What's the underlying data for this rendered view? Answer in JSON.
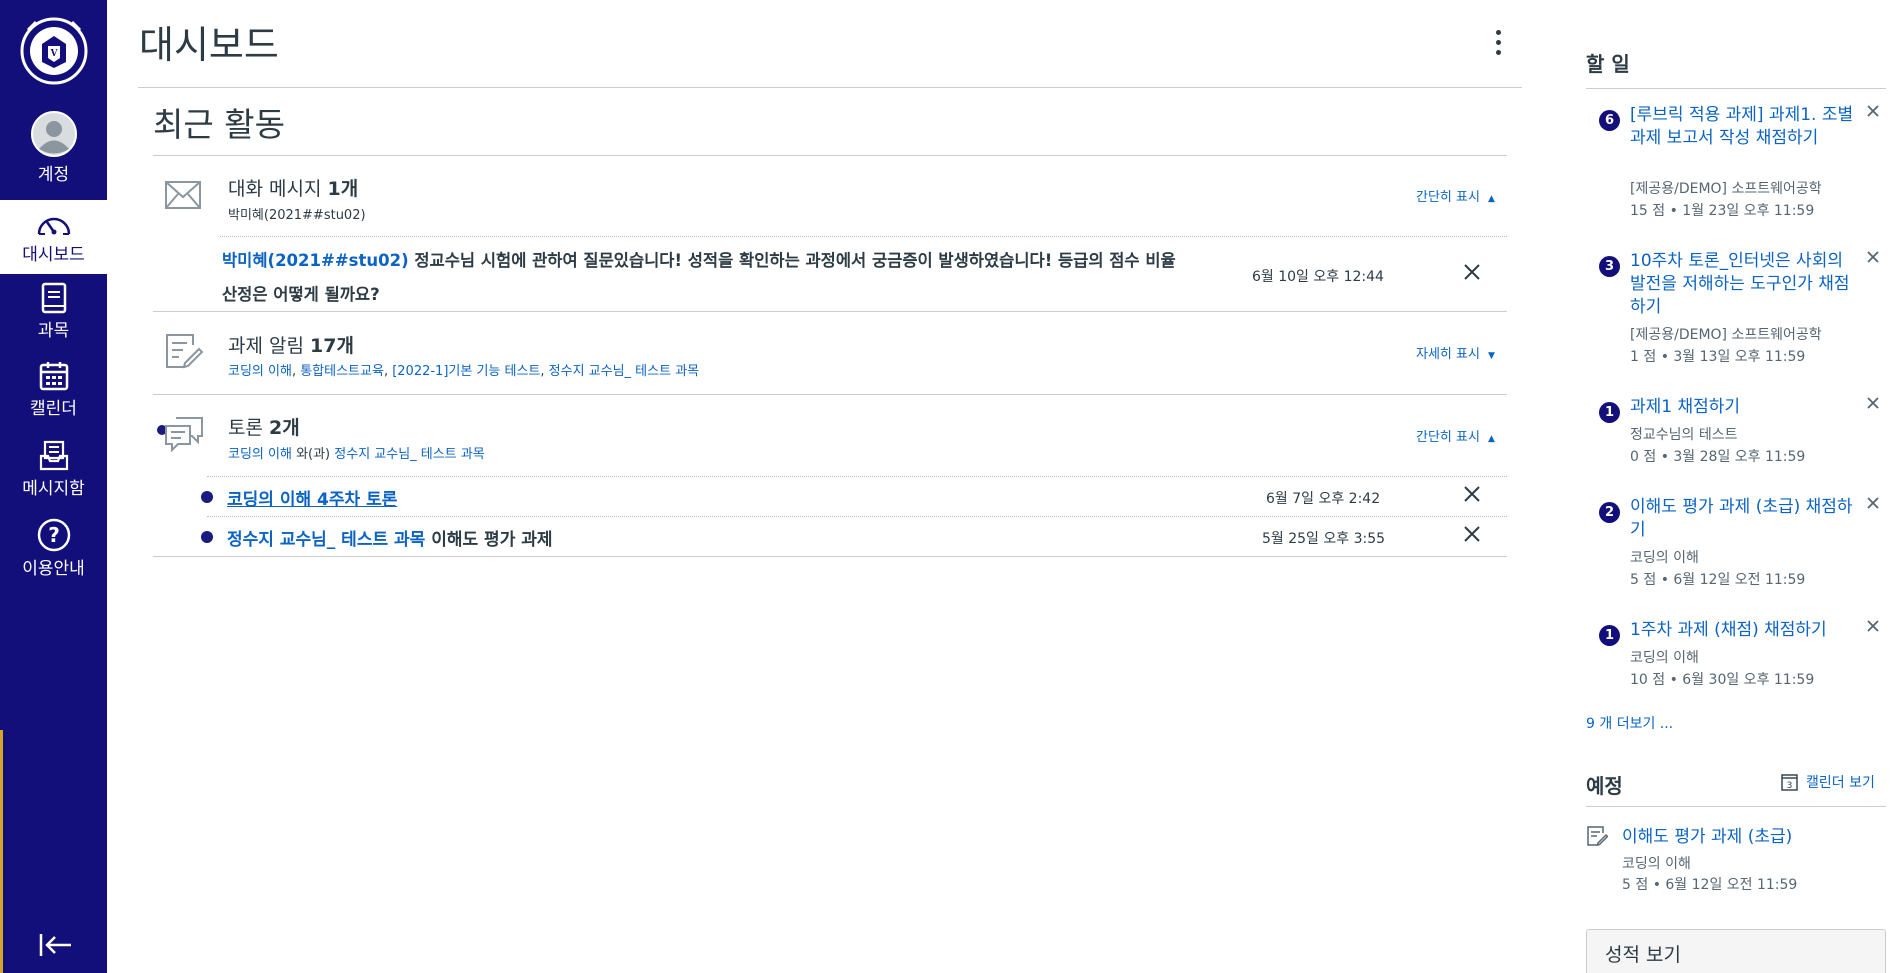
{
  "nav": {
    "logo_text": "VERITAS LUX MEA",
    "items": [
      {
        "label": "계정",
        "icon": "account-avatar-icon"
      },
      {
        "label": "대시보드",
        "icon": "dashboard-gauge-icon"
      },
      {
        "label": "과목",
        "icon": "courses-book-icon"
      },
      {
        "label": "캘린더",
        "icon": "calendar-icon"
      },
      {
        "label": "메시지함",
        "icon": "inbox-icon"
      },
      {
        "label": "이용안내",
        "icon": "help-question-icon"
      }
    ],
    "collapse_icon": "collapse-arrow-icon",
    "colors": {
      "background": "#130f7a",
      "accent": "#d7a42b"
    }
  },
  "header": {
    "title": "대시보드",
    "menu_icon": "kebab-menu-icon"
  },
  "activity": {
    "title": "최근 활동",
    "message_group": {
      "title_prefix": "대화 메시지 ",
      "count": "1개",
      "sub": "박미혜(2021##stu02)",
      "toggle": "간단히 표시",
      "item": {
        "sender": "박미혜(2021##stu02)",
        "text": " 정교수님 시험에 관하여 질문있습니다! 성적을 확인하는 과정에서 궁금증이 발생하였습니다! 등급의 점수 비율 산정은 어떻게 될까요?",
        "date": "6월 10일 오후 12:44"
      }
    },
    "assignment_group": {
      "title_prefix": "과제 알림 ",
      "count": "17개",
      "courses": [
        "코딩의 이해",
        "통합테스트교육",
        "[2022-1]기본 기능 테스트",
        "정수지 교수님_ 테스트 과목"
      ],
      "sep": ", ",
      "toggle": "자세히 표시"
    },
    "discussion_group": {
      "title_prefix": "토론 ",
      "count": "2개",
      "course_a": "코딩의 이해",
      "join": " 와(과) ",
      "course_b": "정수지 교수님_ 테스트 과목",
      "toggle": "간단히 표시",
      "items": [
        {
          "course": "",
          "title": "코딩의 이해 4주차 토론",
          "date": "6월 7일 오후 2:42"
        },
        {
          "course": "정수지 교수님_ 테스트 과목",
          "title": " 이해도 평가 과제",
          "date": "5월 25일 오후 3:55"
        }
      ]
    }
  },
  "todo": {
    "title": "할 일",
    "items": [
      {
        "badge": "6",
        "title": "[루브릭 적용 과제] 과제1. 조별 과제 보고서 작성 채점하기",
        "course": "[제공용/DEMO] 소프트웨어공학",
        "meta": "15 점 • 1월 23일 오후 11:59"
      },
      {
        "badge": "3",
        "title": "10주차 토론_인터넷은 사회의 발전을 저해하는 도구인가 채점하기",
        "course": "[제공용/DEMO] 소프트웨어공학",
        "meta": "1 점 • 3월 13일 오후 11:59"
      },
      {
        "badge": "1",
        "title": "과제1 채점하기",
        "course": "정교수님의 테스트",
        "meta": "0 점 • 3월 28일 오후 11:59"
      },
      {
        "badge": "2",
        "title": "이해도 평가 과제 (초급) 채점하기",
        "course": "코딩의 이해",
        "meta": "5 점 • 6월 12일 오전 11:59"
      },
      {
        "badge": "1",
        "title": "1주차 과제 (채점) 채점하기",
        "course": "코딩의 이해",
        "meta": "10 점 • 6월 30일 오후 11:59"
      }
    ],
    "more": "9 개 더보기 ..."
  },
  "upcoming": {
    "title": "예정",
    "calendar_link": "캘린더 보기",
    "calendar_day": "3",
    "item": {
      "title": "이해도 평가 과제 (초급)",
      "course": "코딩의 이해",
      "meta": "5 점 • 6월 12일 오전 11:59"
    }
  },
  "grades_button": "성적 보기"
}
